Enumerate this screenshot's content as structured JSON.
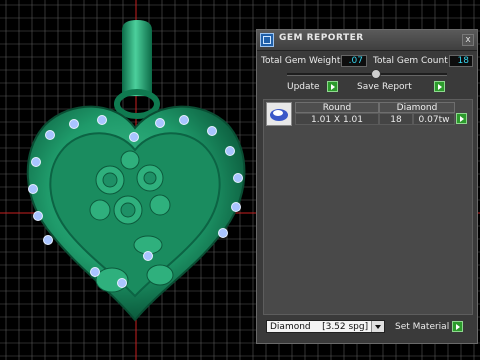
{
  "panel": {
    "title": "GEM REPORTER",
    "close_label": "x",
    "total_weight_label": "Total Gem Weight",
    "total_weight_value": ".07",
    "total_count_label": "Total Gem Count",
    "total_count_value": "18",
    "update_label": "Update",
    "save_report_label": "Save Report",
    "slider_fraction": 0.55
  },
  "gem_table": {
    "headers": [
      "Round",
      "Diamond"
    ],
    "rows": [
      {
        "size": "1.01 X 1.01",
        "count": "18",
        "weight": "0.07tw"
      }
    ]
  },
  "material": {
    "selected": "Diamond    [3.52 spg]",
    "set_label": "Set Material"
  },
  "colors": {
    "model_green": "#1f9a6a",
    "grid": "#ffffff",
    "axis_red": "#c62020",
    "gem_blue": "#a9c4ff",
    "value_text": "#36d6f0",
    "button_green": "#2c9b2c"
  }
}
